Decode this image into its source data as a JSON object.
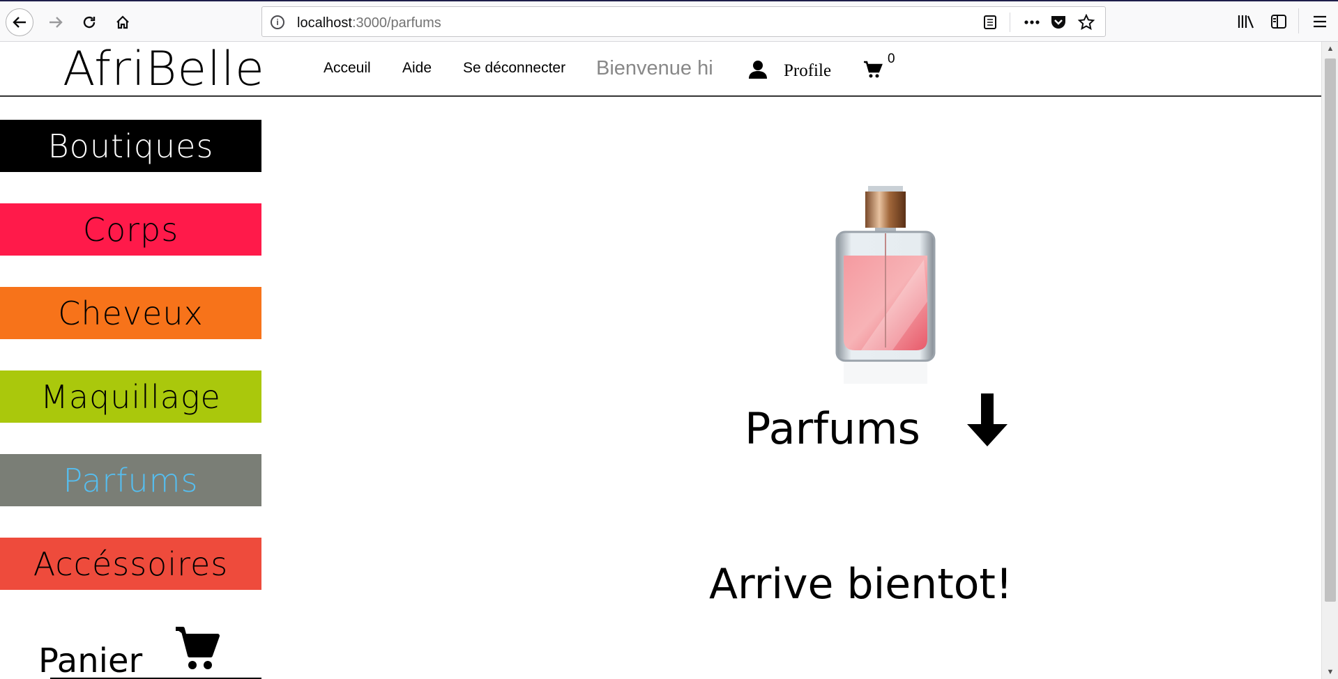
{
  "browser": {
    "url_host": "localhost",
    "url_path": ":3000/parfums"
  },
  "site": {
    "logo": "AfriBelle",
    "nav": [
      "Acceuil",
      "Aide",
      "Se déconnecter"
    ],
    "welcome": "Bienvenue hi",
    "profile_label": "Profile",
    "cart_count": "0"
  },
  "sidebar": {
    "items": [
      {
        "label": "Boutiques",
        "bg": "#000000",
        "color": "#ffffff"
      },
      {
        "label": "Corps",
        "bg": "#ff1a4a",
        "color": "#000000"
      },
      {
        "label": "Cheveux",
        "bg": "#f7731a",
        "color": "#000000"
      },
      {
        "label": "Maquillage",
        "bg": "#aac80c",
        "color": "#000000"
      },
      {
        "label": "Parfums",
        "bg": "#7a7e76",
        "color": "#55bef0"
      },
      {
        "label": "Accéssoires",
        "bg": "#ee4b3c",
        "color": "#000000"
      }
    ],
    "panier_label": "Panier"
  },
  "main": {
    "title": "Parfums",
    "message": "Arrive bientot!"
  }
}
